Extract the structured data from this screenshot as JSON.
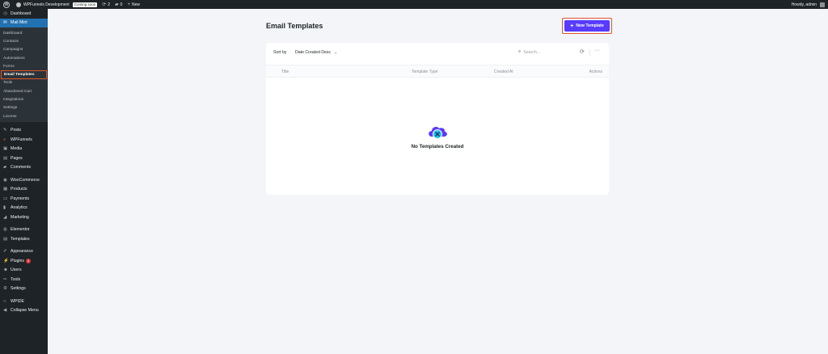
{
  "adminbar": {
    "site_name": "WPFunnels Development",
    "coming_soon": "Coming soon",
    "updates_count": "2",
    "comments_count": "0",
    "new_label": "New",
    "howdy": "Howdy, admin"
  },
  "sidebar": {
    "dashboard": "Dashboard",
    "mail_mint": "Mail Mint",
    "submenu": [
      "Dashboard",
      "Contacts",
      "Campaigns",
      "Automations",
      "Forms",
      "Email Templates",
      "Tools",
      "Abandoned Cart",
      "Integrations",
      "Settings",
      "License"
    ],
    "group1": [
      "Posts",
      "WPFunnels",
      "Media",
      "Pages",
      "Comments"
    ],
    "group2": [
      "WooCommerce",
      "Products",
      "Payments",
      "Analytics",
      "Marketing"
    ],
    "group3": [
      "Elementor",
      "Templates"
    ],
    "group4": [
      "Appearance",
      "Plugins",
      "Users",
      "Tools",
      "Settings"
    ],
    "plugins_badge": "2",
    "wpide": "WPIDE",
    "collapse": "Collapse Menu"
  },
  "main": {
    "title": "Email Templates",
    "new_button": "New Template",
    "sort_label": "Sort by",
    "sort_value": "Date Created Desc",
    "search_placeholder": "Search...",
    "columns": [
      "Title",
      "Template Type",
      "Created At",
      "Actions"
    ],
    "empty_message": "No Templates Created"
  },
  "colors": {
    "accent": "#573bff",
    "wp_blue": "#2271b1",
    "highlight_outline": "#e0562e"
  }
}
